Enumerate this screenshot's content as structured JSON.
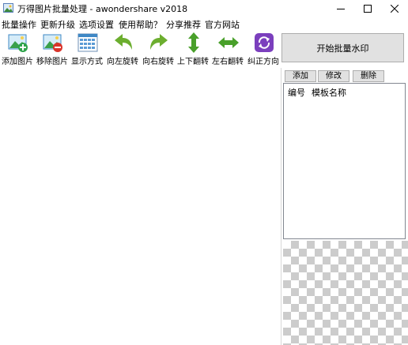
{
  "window": {
    "title": "万得图片批量处理 - awondershare v2018",
    "controls": [
      "minimize",
      "maximize",
      "close"
    ]
  },
  "menu": [
    {
      "label": "批量操作"
    },
    {
      "label": "更新升级"
    },
    {
      "label": "选项设置"
    },
    {
      "label": "使用帮助？"
    },
    {
      "label": "分享推荐"
    },
    {
      "label": "官方网站"
    }
  ],
  "toolbar": [
    {
      "label": "添加图片",
      "icon": "add-image-icon"
    },
    {
      "label": "移除图片",
      "icon": "remove-image-icon"
    },
    {
      "label": "显示方式",
      "icon": "display-mode-icon"
    },
    {
      "label": "向左旋转",
      "icon": "rotate-left-icon"
    },
    {
      "label": "向右旋转",
      "icon": "rotate-right-icon"
    },
    {
      "label": "上下翻转",
      "icon": "flip-vertical-icon"
    },
    {
      "label": "左右翻转",
      "icon": "flip-horizontal-icon"
    },
    {
      "label": "纠正方向",
      "icon": "correct-orientation-icon"
    }
  ],
  "right_panel": {
    "start_button": "开始批量水印",
    "template_buttons": [
      {
        "label": "添加"
      },
      {
        "label": "修改"
      },
      {
        "label": "删除"
      }
    ],
    "template_list": {
      "columns": [
        "编号",
        "模板名称"
      ],
      "rows": []
    }
  },
  "colors": {
    "arrow_green": "#6cae2f",
    "flip_green": "#49a02a",
    "purple": "#7b3fbd",
    "button_face": "#e1e1e1"
  }
}
